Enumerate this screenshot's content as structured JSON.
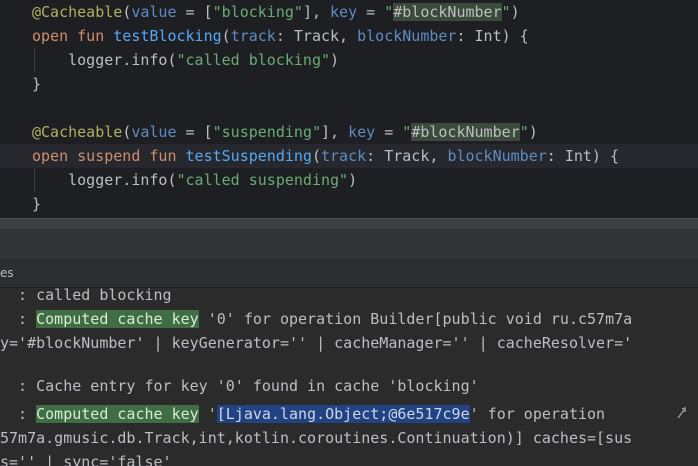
{
  "editor": {
    "l1": {
      "annot": "@Cacheable",
      "p1": "(",
      "value_kw": "value",
      "eq1": " = [",
      "val_str": "\"blocking\"",
      "mid": "], ",
      "key_kw": "key",
      "eq2": " = ",
      "q1": "\"",
      "key_expr": "#blockNumber",
      "q2": "\"",
      "end": ")"
    },
    "l2": {
      "open": "open",
      "fun": "fun",
      "name": "testBlocking",
      "lp": "(",
      "p_track": "track",
      "t_track": ": Track, ",
      "p_block": "blockNumber",
      "t_block": ": Int) {"
    },
    "l3": {
      "logger": "logger.info(",
      "msg": "\"called blocking\"",
      "rp": ")"
    },
    "l4": {
      "brace": "}"
    },
    "l6": {
      "annot": "@Cacheable",
      "p1": "(",
      "value_kw": "value",
      "eq1": " = [",
      "val_str": "\"suspending\"",
      "mid": "], ",
      "key_kw": "key",
      "eq2": " = ",
      "q1": "\"",
      "key_expr": "#blockNumber",
      "q2": "\"",
      "end": ")"
    },
    "l7": {
      "open": "open",
      "suspend": "suspend",
      "fun": "fun",
      "name": "testSuspending",
      "lp": "(",
      "p_track": "track",
      "t_track": ": Track, ",
      "p_block": "blockNumber",
      "t_block": ": Int) {"
    },
    "l8": {
      "logger": "logger.info(",
      "msg": "\"called suspending\"",
      "rp": ")"
    },
    "l9": {
      "brace": "}"
    }
  },
  "tabs": {
    "label": "es"
  },
  "console": {
    "c1": {
      "text": "  : called blocking"
    },
    "c2": {
      "pre": "  : ",
      "hl": "Computed cache key",
      "post": " '0' for operation Builder[public void ru.c57m7a"
    },
    "c3": {
      "text": "y='#blockNumber' | keyGenerator='' | cacheManager='' | cacheResolver='"
    },
    "c5": {
      "text": "  : Cache entry for key '0' found in cache 'blocking'"
    },
    "c6": {
      "pre": "  : ",
      "hl": "Computed cache key",
      "mid": " '",
      "key": "[Ljava.lang.Object;@6e517c9e",
      "post": "' for operation "
    },
    "c7": {
      "text": "57m7a.gmusic.db.Track,int,kotlin.coroutines.Continuation)] caches=[sus"
    },
    "c8": {
      "text": "s='' | sync='false'"
    }
  }
}
